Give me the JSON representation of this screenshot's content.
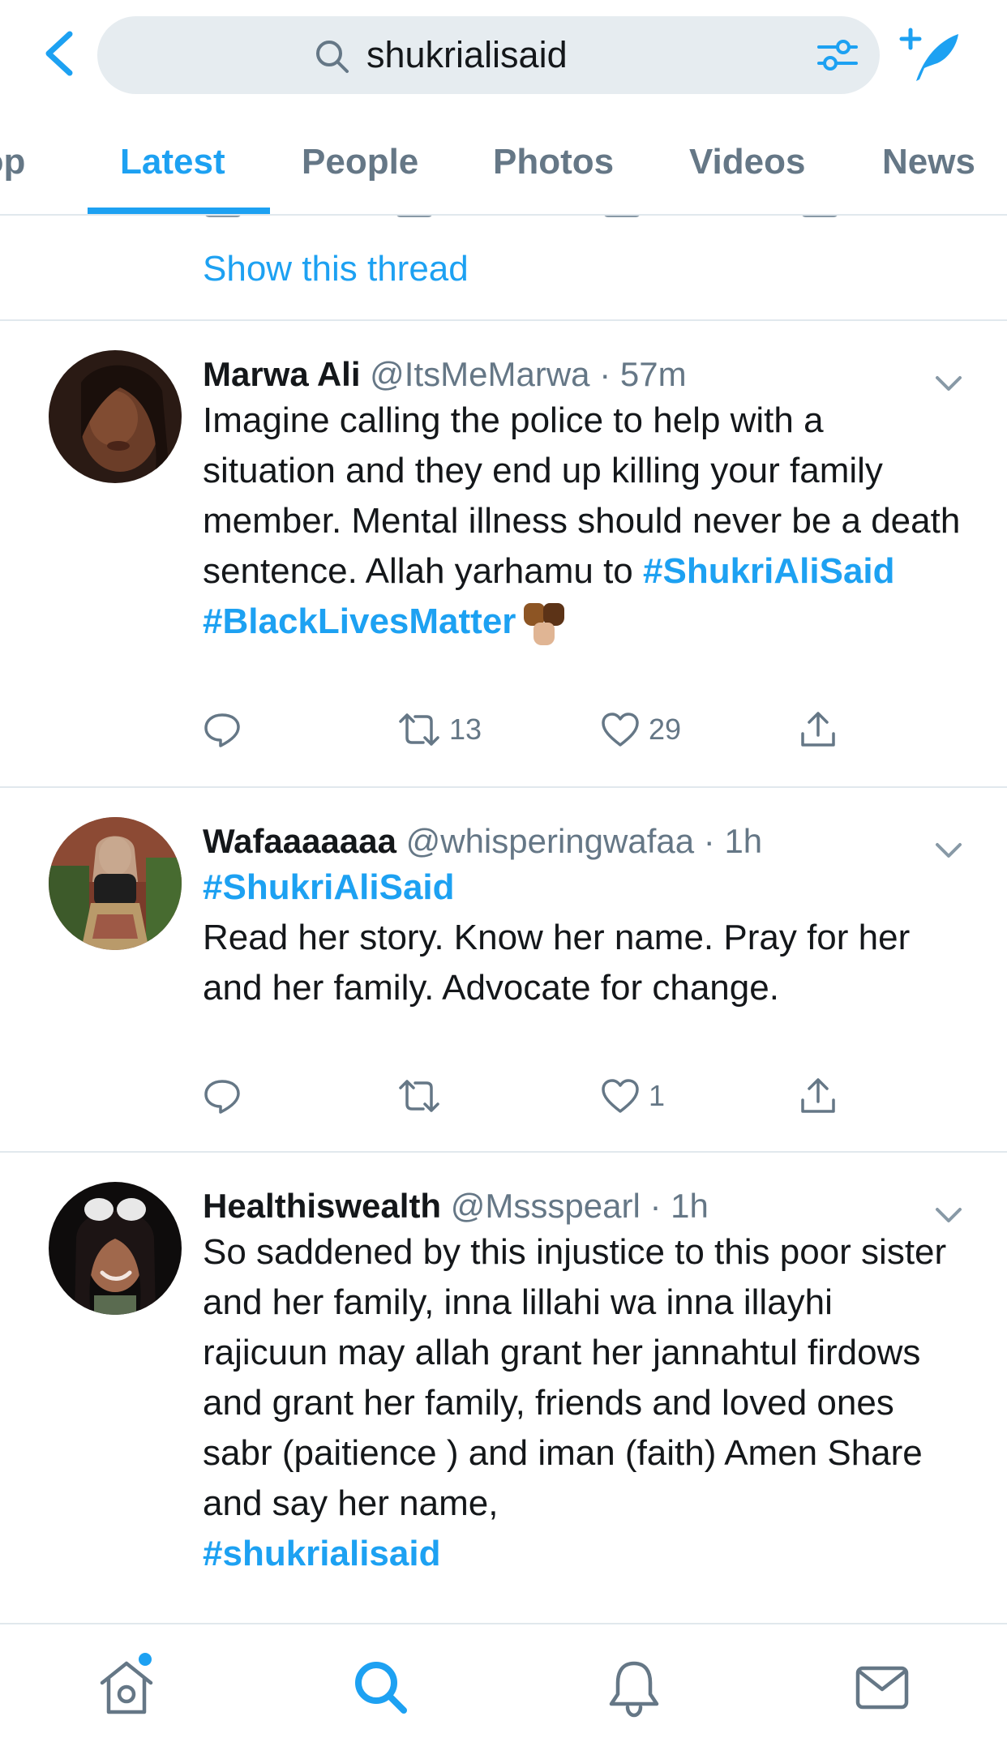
{
  "search": {
    "query": "shukrialisaid"
  },
  "tabs": [
    {
      "label": "Top"
    },
    {
      "label": "Latest"
    },
    {
      "label": "People"
    },
    {
      "label": "Photos"
    },
    {
      "label": "Videos"
    },
    {
      "label": "News"
    }
  ],
  "active_tab": "Latest",
  "thread_link": "Show this thread",
  "tweets": [
    {
      "name": "Marwa Ali",
      "handle": "@ItsMeMarwa",
      "separator": "·",
      "time": "57m",
      "text": "Imagine calling the police to help with a situation and they end up killing your family member. Mental illness should never be a death sentence. Allah yarhamu to ",
      "hashtag1": "#ShukriAliSaid",
      "hashtag2": "#BlackLivesMatter",
      "emoji": "raised-fists-emoji",
      "replies": "",
      "retweets": "13",
      "likes": "29"
    },
    {
      "name": "Wafaaaaaaa",
      "handle": "@whisperingwafaa",
      "separator": "·",
      "time": "1h",
      "hashtag1": "#ShukriAliSaid",
      "text": "Read her story. Know her name. Pray for her and her family. Advocate for change.",
      "replies": "",
      "retweets": "",
      "likes": "1"
    },
    {
      "name": "Healthiswealth",
      "handle": "@Mssspearl",
      "separator": "·",
      "time": "1h",
      "text": "So saddened by this injustice to this poor sister and her family, inna lillahi wa inna illayhi rajicuun may allah grant her jannahtul firdows and grant her family, friends and loved ones sabr (paitience ) and iman (faith) Amen Share and say her name,",
      "hashtag1": "#shukrialisaid"
    }
  ],
  "colors": {
    "accent": "#1da1f2",
    "text": "#14171a",
    "secondary": "#657786",
    "divider": "#e1e8ed",
    "search_bg": "#e6ecf0"
  },
  "icons": {
    "back": "chevron-left-icon",
    "search": "search-icon",
    "filter": "sliders-icon",
    "compose": "compose-tweet-icon",
    "nav": [
      "home-icon",
      "search-icon",
      "bell-icon",
      "mail-icon"
    ]
  }
}
